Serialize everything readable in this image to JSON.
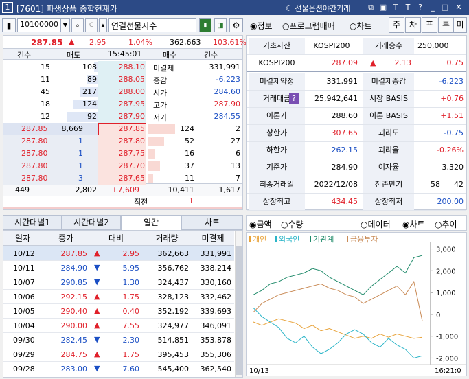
{
  "titlebar": {
    "number": "1",
    "title": "[7601] 파생상품 종합현재가",
    "night": "선물옵션야간거래"
  },
  "toolbar": {
    "code": "10100000",
    "name": "연결선물지수",
    "radios": [
      "정보",
      "프로그램매매",
      "차트"
    ],
    "buttons": [
      "주",
      "차",
      "프",
      "투",
      "미"
    ]
  },
  "quote": {
    "price": "287.85",
    "change": "2.95",
    "rate": "1.04%",
    "volume": "362,663",
    "ratio": "103.61%"
  },
  "orderbook": {
    "headers": [
      "건수",
      "매도",
      "15:45:01",
      "매수",
      "건수"
    ],
    "asks": [
      {
        "cnt": "15",
        "qty": "108",
        "price": "288.10",
        "label": "미결제",
        "value": "331,991"
      },
      {
        "cnt": "11",
        "qty": "89",
        "price": "288.05",
        "label": "증감",
        "value": "-6,223"
      },
      {
        "cnt": "45",
        "qty": "217",
        "price": "288.00",
        "label": "시가",
        "value": "284.60"
      },
      {
        "cnt": "18",
        "qty": "124",
        "price": "287.95",
        "label": "고가",
        "value": "287.90"
      },
      {
        "cnt": "12",
        "qty": "92",
        "price": "287.90",
        "label": "저가",
        "value": "284.55"
      }
    ],
    "bids": [
      {
        "trade": "287.85",
        "tqty": "8,669",
        "price": "287.85",
        "qty": "124",
        "cnt": "2"
      },
      {
        "trade": "287.80",
        "tqty": "1",
        "price": "287.80",
        "qty": "52",
        "cnt": "27"
      },
      {
        "trade": "287.80",
        "tqty": "1",
        "price": "287.75",
        "qty": "16",
        "cnt": "6"
      },
      {
        "trade": "287.80",
        "tqty": "1",
        "price": "287.70",
        "qty": "37",
        "cnt": "13"
      },
      {
        "trade": "287.80",
        "tqty": "3",
        "price": "287.65",
        "qty": "11",
        "cnt": "7"
      }
    ],
    "totals": [
      "449",
      "2,802",
      "+7,609",
      "10,411",
      "1,617"
    ],
    "footer": {
      "label": "직전",
      "value": "1"
    }
  },
  "info": {
    "row0": {
      "a": "기초자산",
      "b": "KOSPI200",
      "c": "거래승수",
      "d": "250,000"
    },
    "row1": {
      "a": "KOSPI200",
      "b": "287.09",
      "c": "2.13",
      "d": "0.75"
    },
    "rows": [
      {
        "l1": "미결제약정",
        "v1": "331,991",
        "l2": "미결제증감",
        "v2": "-6,223"
      },
      {
        "l1": "거래대금",
        "v1": "25,942,641",
        "l2": "시장 BASIS",
        "v2": "+0.76"
      },
      {
        "l1": "이론가",
        "v1": "288.60",
        "l2": "이론 BASIS",
        "v2": "+1.51"
      },
      {
        "l1": "상한가",
        "v1": "307.65",
        "l2": "괴리도",
        "v2": "-0.75"
      },
      {
        "l1": "하한가",
        "v1": "262.15",
        "l2": "괴리율",
        "v2": "-0.26%"
      },
      {
        "l1": "기준가",
        "v1": "284.90",
        "l2": "이자율",
        "v2": "3.320"
      },
      {
        "l1": "최종거래일",
        "v1": "2022/12/08",
        "l2": "잔존만기",
        "v2a": "58",
        "v2": "42"
      },
      {
        "l1": "상장최고",
        "v1": "434.45",
        "l2": "상장최저",
        "v2": "200.00"
      }
    ]
  },
  "tabs": [
    "시간대별1",
    "시간대별2",
    "일간",
    "차트"
  ],
  "daily": {
    "headers": [
      "일자",
      "종가",
      "대비",
      "거래량",
      "미결제"
    ],
    "rows": [
      {
        "d": "10/12",
        "c": "287.85",
        "dir": "up",
        "chg": "2.95",
        "v": "362,663",
        "oi": "331,991"
      },
      {
        "d": "10/11",
        "c": "284.90",
        "dir": "down",
        "chg": "5.95",
        "v": "356,762",
        "oi": "338,214"
      },
      {
        "d": "10/07",
        "c": "290.85",
        "dir": "down",
        "chg": "1.30",
        "v": "324,437",
        "oi": "330,160"
      },
      {
        "d": "10/06",
        "c": "292.15",
        "dir": "up",
        "chg": "1.75",
        "v": "328,123",
        "oi": "332,462"
      },
      {
        "d": "10/05",
        "c": "290.40",
        "dir": "up",
        "chg": "0.40",
        "v": "352,192",
        "oi": "339,693"
      },
      {
        "d": "10/04",
        "c": "290.00",
        "dir": "up",
        "chg": "7.55",
        "v": "324,977",
        "oi": "346,091"
      },
      {
        "d": "09/30",
        "c": "282.45",
        "dir": "down",
        "chg": "2.30",
        "v": "514,851",
        "oi": "353,878"
      },
      {
        "d": "09/29",
        "c": "284.75",
        "dir": "up",
        "chg": "1.75",
        "v": "395,453",
        "oi": "355,306"
      },
      {
        "d": "09/28",
        "c": "283.00",
        "dir": "down",
        "chg": "7.60",
        "v": "545,400",
        "oi": "362,540"
      }
    ]
  },
  "chartpanel": {
    "radioA": [
      "금액",
      "수량"
    ],
    "radioB": [
      "데이터",
      "차트",
      "추이"
    ],
    "legend": [
      "개인",
      "외국인",
      "기관계",
      "금융투자"
    ],
    "colors": [
      "#e8a33a",
      "#2bb5c8",
      "#1f8a6a",
      "#c98a55"
    ],
    "footer_left": "10/13",
    "footer_right": "16:21:0"
  },
  "chart_data": {
    "type": "line",
    "ylim": [
      -2300,
      3300
    ],
    "yticks": [
      3000,
      2000,
      1000,
      0,
      -1000,
      -2000
    ],
    "ytick_labels": [
      "3,000",
      "2,000",
      "1,000",
      "0",
      "-1,000",
      "-2,000"
    ],
    "series": [
      {
        "name": "개인",
        "values": [
          -350,
          -500,
          -350,
          -200,
          -300,
          -400,
          -650,
          -500,
          -750,
          -650,
          -800,
          -950,
          -1100,
          -1000,
          -1100,
          -900,
          -1050,
          -900,
          -1000,
          -1100,
          -1050
        ]
      },
      {
        "name": "외국인",
        "values": [
          300,
          -100,
          -350,
          -600,
          -1100,
          -1300,
          -1000,
          -1500,
          -1800,
          -1600,
          -1300,
          -900,
          -700,
          -900,
          -1300,
          -1500,
          -1100,
          -1400,
          -1600,
          -2000,
          -1900
        ]
      },
      {
        "name": "기관계",
        "values": [
          900,
          1100,
          1400,
          1500,
          1700,
          1800,
          1900,
          2100,
          2000,
          1700,
          1500,
          1300,
          1100,
          900,
          1300,
          1600,
          1900,
          2200,
          1900,
          2600,
          2700
        ]
      },
      {
        "name": "금융투자",
        "values": [
          100,
          500,
          700,
          900,
          1000,
          1100,
          1200,
          1300,
          1400,
          1200,
          1100,
          900,
          800,
          500,
          700,
          900,
          1100,
          1300,
          900,
          1500,
          -300
        ]
      }
    ]
  }
}
